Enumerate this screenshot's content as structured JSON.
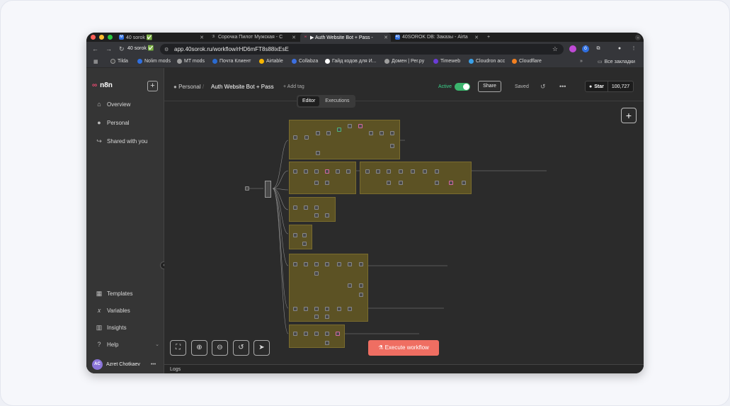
{
  "browser": {
    "tabs": [
      {
        "title": "40 sorok ✅",
        "color": "#2f6fe0",
        "fav": "M",
        "active": false
      },
      {
        "title": "Сорочка Пилот Мужская - С",
        "color": "#777777",
        "fav": "",
        "active": false
      },
      {
        "title": "▶ Auth Website Bot + Pass -",
        "color": "#ea4b71",
        "fav": "",
        "active": true
      },
      {
        "title": "40SOROK DB: Заказы - Airta",
        "color": "#2f6fe0",
        "fav": "40",
        "active": false
      }
    ],
    "site_chip": "40 sorok ✅",
    "url": "app.40sorok.ru/workflow/rHD6mFT8s88ixEsE",
    "bookmarks": [
      {
        "label": "Tilda",
        "color": "#444444"
      },
      {
        "label": "Nolim mods",
        "color": "#2f6fe0"
      },
      {
        "label": "MT mods",
        "color": "#9e9e9e"
      },
      {
        "label": "Почта Клиент",
        "color": "#2a6bd1"
      },
      {
        "label": "Airtable",
        "color": "#f7b500"
      },
      {
        "label": "Collabza",
        "color": "#3c6fe0"
      },
      {
        "label": "Гайд кодов для И...",
        "color": "#ffffff"
      },
      {
        "label": "Домен | Рег.ру",
        "color": "#9e9e9e"
      },
      {
        "label": "Timeweb",
        "color": "#6b3cd6"
      },
      {
        "label": "Cloudron acc",
        "color": "#3aa0e8"
      },
      {
        "label": "Cloudflare",
        "color": "#f38020"
      }
    ],
    "all_bookmarks": "Все закладки"
  },
  "sidebar": {
    "brand": "n8n",
    "nav": [
      {
        "label": "Overview",
        "icon": "⌂"
      },
      {
        "label": "Personal",
        "icon": "●"
      },
      {
        "label": "Shared with you",
        "icon": "↪"
      }
    ],
    "bottom": [
      {
        "label": "Templates",
        "icon": "▦"
      },
      {
        "label": "Variables",
        "icon": "𝑥"
      },
      {
        "label": "Insights",
        "icon": "▥"
      },
      {
        "label": "Help",
        "icon": "?"
      }
    ],
    "user": {
      "initials": "AC",
      "name": "Azret Chotkaev"
    }
  },
  "header": {
    "project": "Personal",
    "workflow": "Auth Website Bot + Pass",
    "add_tag": "+ Add tag",
    "active_label": "Active",
    "share": "Share",
    "saved": "Saved",
    "github_star": "Star",
    "github_count": "100,727",
    "view_tabs": [
      "Editor",
      "Executions"
    ]
  },
  "canvas": {
    "execute": "Execute workflow",
    "logs": "Logs"
  },
  "colors": {
    "accent": "#ef6e62",
    "active": "#3bb56d",
    "sticky": "#5c5224"
  }
}
